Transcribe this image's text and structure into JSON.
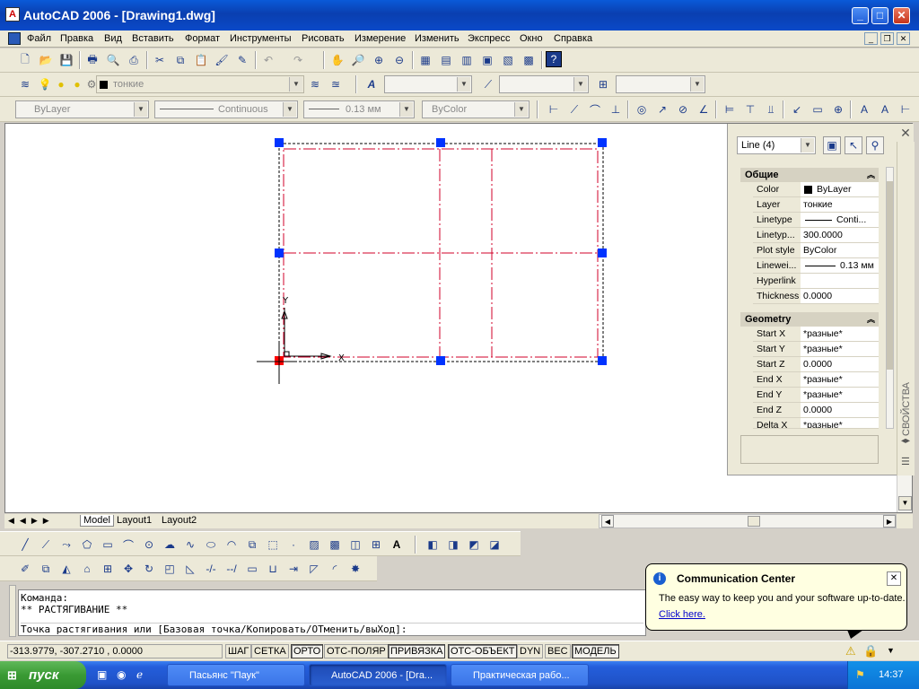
{
  "window": {
    "title": "AutoCAD 2006 - [Drawing1.dwg]",
    "app_icon": "A"
  },
  "menu": {
    "items": [
      "Файл",
      "Правка",
      "Вид",
      "Вставить",
      "Формат",
      "Инструменты",
      "Рисовать",
      "Измерение",
      "Изменить",
      "Экспресс",
      "Окно",
      "Справка"
    ]
  },
  "layers_toolbar": {
    "layer": "тонкие"
  },
  "properties_toolbar": {
    "color": "ByLayer",
    "linetype": "Continuous",
    "lineweight": "0.13 мм",
    "plotstyle": "ByColor"
  },
  "palette": {
    "selection": "Line (4)",
    "side_title": "СВОЙСТВА",
    "general": {
      "header": "Общие",
      "rows": [
        {
          "k": "Color",
          "v": "ByLayer"
        },
        {
          "k": "Layer",
          "v": "тонкие"
        },
        {
          "k": "Linetype",
          "v": "Conti..."
        },
        {
          "k": "Linetyp...",
          "v": "300.0000"
        },
        {
          "k": "Plot style",
          "v": "ByColor"
        },
        {
          "k": "Linewei...",
          "v": "0.13 мм"
        },
        {
          "k": "Hyperlink",
          "v": ""
        },
        {
          "k": "Thickness",
          "v": "0.0000"
        }
      ]
    },
    "geometry": {
      "header": "Geometry",
      "rows": [
        {
          "k": "Start X",
          "v": "*разные*"
        },
        {
          "k": "Start Y",
          "v": "*разные*"
        },
        {
          "k": "Start Z",
          "v": "0.0000"
        },
        {
          "k": "End X",
          "v": "*разные*"
        },
        {
          "k": "End Y",
          "v": "*разные*"
        },
        {
          "k": "End Z",
          "v": "0.0000"
        },
        {
          "k": "Delta X",
          "v": "*разные*"
        }
      ]
    }
  },
  "ucs": {
    "x_label": "X",
    "y_label": "Y"
  },
  "tabs": [
    "Model",
    "Layout1",
    "Layout2"
  ],
  "command": {
    "lines": [
      "Команда:",
      "** РАСТЯГИВАНИЕ **",
      "Точка растягивания или [Базовая точка/Копировать/ОТменить/выХод]:"
    ]
  },
  "status": {
    "coords": "-313.9779,  -307.2710 , 0.0000",
    "buttons": [
      "ШАГ",
      "СЕТКА",
      "ОРТО",
      "ОТС-ПОЛЯР",
      "ПРИВЯЗКА",
      "ОТС-ОБЪЕКТ",
      "DYN",
      "ВЕС",
      "МОДЕЛЬ"
    ],
    "active": [
      2,
      4,
      5,
      8
    ]
  },
  "balloon": {
    "title": "Communication Center",
    "text": "The easy way to keep you and your software up-to-date.",
    "link": "Click here."
  },
  "taskbar": {
    "start": "пуск",
    "tasks": [
      "Пасьянс \"Паук\"",
      "AutoCAD 2006 - [Dra...",
      "Практическая рабо..."
    ],
    "clock": "14:37"
  },
  "colors": {
    "selection_red": "#d0002a",
    "grip_blue": "#0033ff",
    "xp_blue": "#245edb"
  }
}
